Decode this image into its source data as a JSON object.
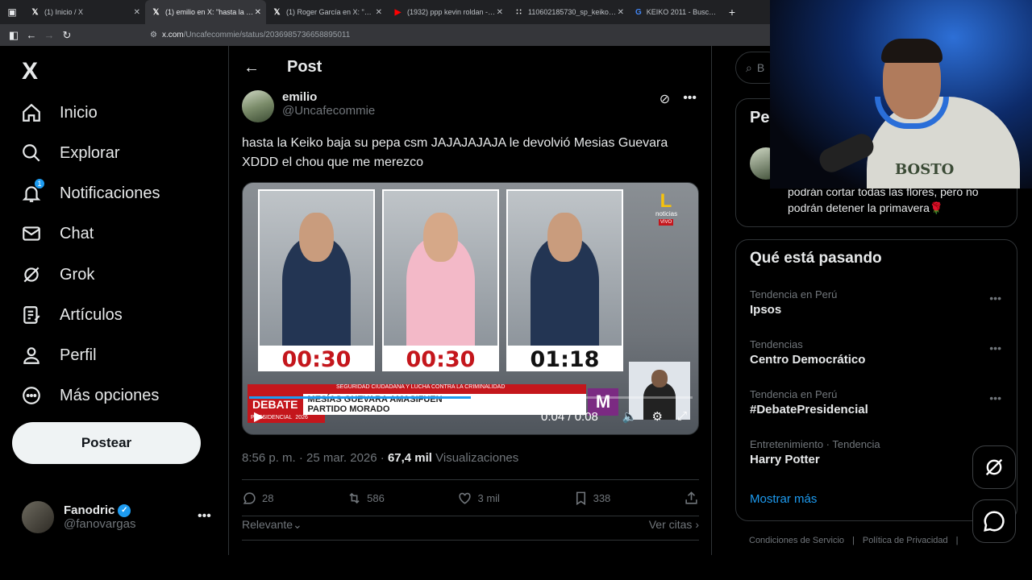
{
  "browser": {
    "tabs": [
      {
        "label": "(1) Inicio / X",
        "active": false
      },
      {
        "label": "(1) emilio en X: \"hasta la Keiko b",
        "active": true
      },
      {
        "label": "(1) Roger García en X: \"xd https:",
        "active": false
      },
      {
        "label": "(1932) ppp kevin roldan - YouTu",
        "active": false
      },
      {
        "label": "110602185730_sp_keiko_yoshi",
        "active": false
      },
      {
        "label": "KEIKO 2011 - Buscar con Googl",
        "active": false
      }
    ],
    "new_tab": "+",
    "url_host": "x.com",
    "url_path": "/Uncafecommie/status/2036985736658895011"
  },
  "sidebar": {
    "logo": "X",
    "items": [
      {
        "label": "Inicio",
        "icon": "home-icon"
      },
      {
        "label": "Explorar",
        "icon": "search-icon"
      },
      {
        "label": "Notificaciones",
        "icon": "bell-icon",
        "badge": "1"
      },
      {
        "label": "Chat",
        "icon": "mail-icon"
      },
      {
        "label": "Grok",
        "icon": "grok-icon"
      },
      {
        "label": "Artículos",
        "icon": "article-icon"
      },
      {
        "label": "Perfil",
        "icon": "profile-icon"
      },
      {
        "label": "Más opciones",
        "icon": "more-icon"
      }
    ],
    "post_button": "Postear",
    "account": {
      "name": "Fanodric",
      "handle": "@fanovargas",
      "verified": true
    }
  },
  "post": {
    "header_title": "Post",
    "author_name": "emilio",
    "author_handle": "@Uncafecommie",
    "text": "hasta la Keiko baja su pepa csm JAJAJAJAJA le devolvió Mesias Guevara XDDD el chou que me merezco",
    "video": {
      "timers": [
        "00:30",
        "00:30",
        "01:18"
      ],
      "banner_title": "DEBATE",
      "banner_sub": "PRESIDENCIAL",
      "banner_year": "2026",
      "headline_top": "SEGURIDAD CIUDADANA Y LUCHA CONTRA LA CRIMINALIDAD",
      "headline_main": "MESÍAS GUEVARA AMASIFUEN",
      "headline_party": "PARTIDO MORADO",
      "channel_logo": "L",
      "channel_name": "noticias",
      "live_label": "VIVO",
      "party_logo": "M",
      "time_display": "0:04 / 0:08",
      "progress": 0.5
    },
    "timestamp": "8:56 p. m. · 25 mar. 2026 · ",
    "views_count": "67,4 mil",
    "views_label": " Visualizaciones",
    "stats": {
      "replies": "28",
      "reposts": "586",
      "likes": "3 mil",
      "bookmarks": "338"
    },
    "sort_label": "Relevante",
    "quotes_label": "Ver citas"
  },
  "right": {
    "search_placeholder": "B",
    "box1_title": "Pe",
    "box1_quote": "podrán cortar todas las flores, pero no podrán detener la primavera🌹",
    "trending_title": "Qué está pasando",
    "trends": [
      {
        "context": "Tendencia en Perú",
        "name": "Ipsos"
      },
      {
        "context": "Tendencias",
        "name": "Centro Democrático"
      },
      {
        "context": "Tendencia en Perú",
        "name": "#DebatePresidencial"
      },
      {
        "context": "Entretenimiento · Tendencia",
        "name": "Harry Potter"
      }
    ],
    "show_more": "Mostrar más",
    "footer": [
      "Condiciones de Servicio",
      "|",
      "Política de Privacidad",
      "|"
    ]
  },
  "webcam": {
    "shirt_text": "BOSTO"
  }
}
